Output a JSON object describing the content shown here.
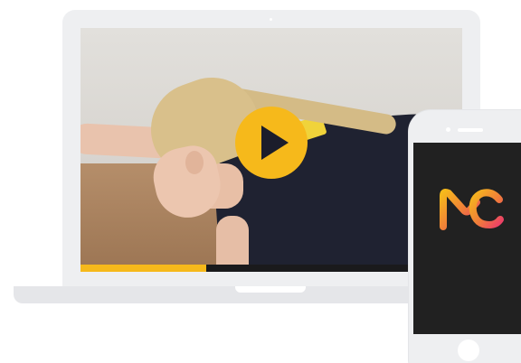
{
  "video_player": {
    "progress": 0.33,
    "play_button_icon": "play-icon",
    "accent_color": "#f6b91b"
  },
  "phone": {
    "logo_text": "MC",
    "logo_colors": [
      "#f6b91b",
      "#ec3f68",
      "#f07d3a"
    ],
    "screen_color": "#212121"
  }
}
